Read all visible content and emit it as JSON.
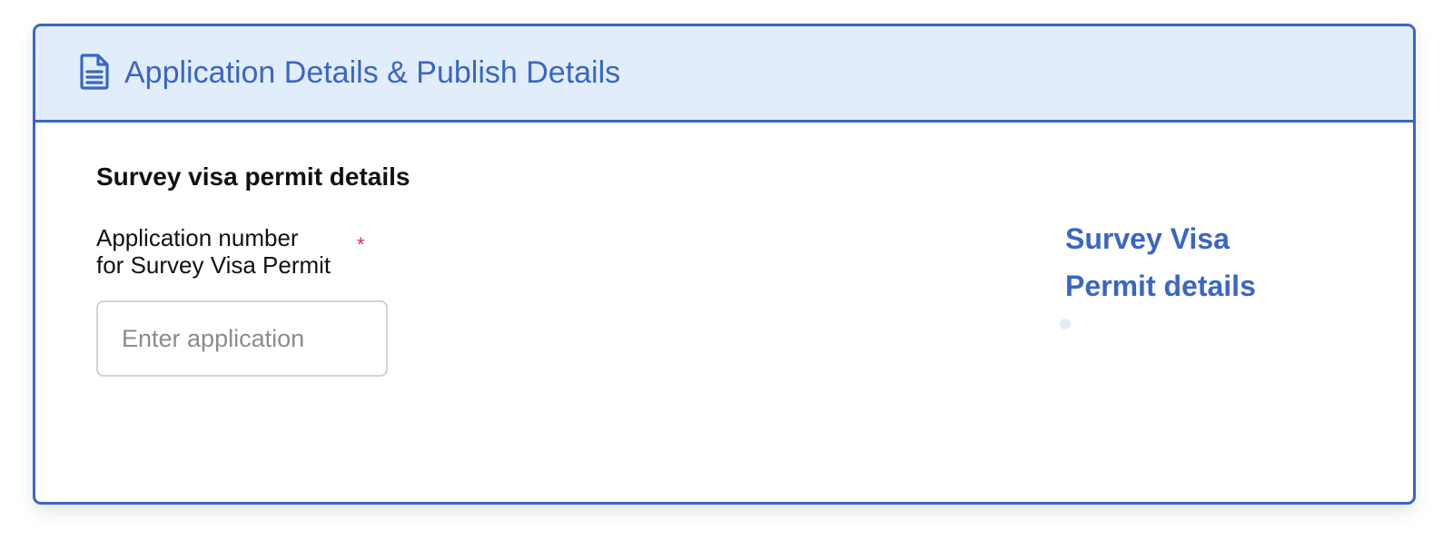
{
  "panel": {
    "icon": "document-icon",
    "title": "Application Details & Publish Details",
    "accent_color": "#3a66c4",
    "header_background": "#e1edfa"
  },
  "section": {
    "title": "Survey visa permit details"
  },
  "field": {
    "label_line1": "Application number",
    "label_line2": "for Survey Visa Permit",
    "required_marker": "*",
    "required_color": "#d62d5a",
    "placeholder": "Enter application",
    "value": ""
  },
  "side_nav": {
    "link_line1": "Survey Visa",
    "link_line2": "Permit details"
  }
}
